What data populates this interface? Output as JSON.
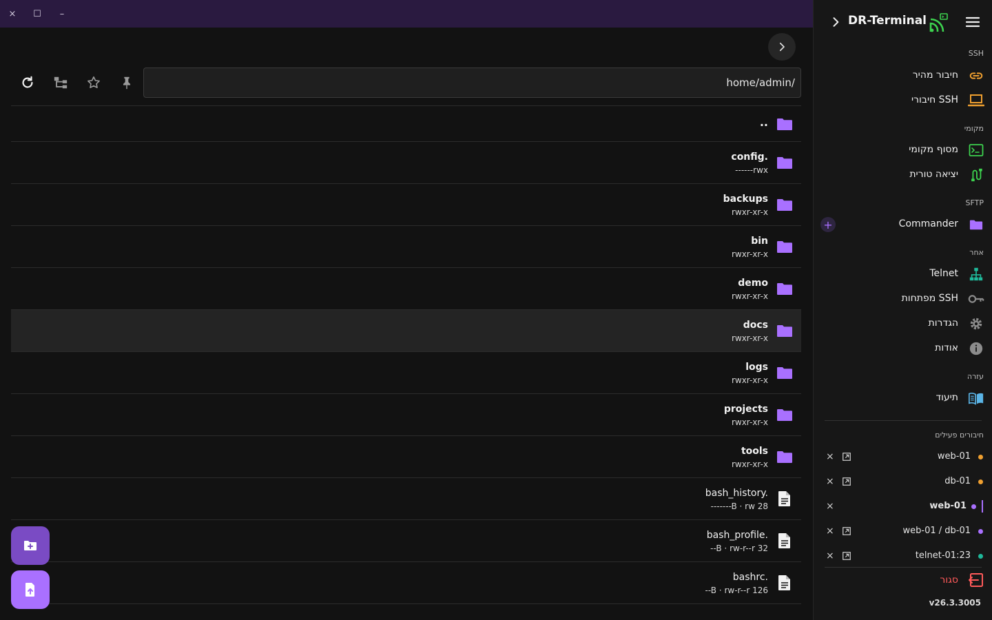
{
  "window": {
    "close": "×",
    "maximize": "☐",
    "minimize": "–"
  },
  "toolbar": {
    "path": "home/admin/"
  },
  "files": [
    {
      "name": "..",
      "perm": "",
      "type": "folder"
    },
    {
      "name": "config.",
      "perm": "------rwx",
      "type": "folder"
    },
    {
      "name": "backups",
      "perm": "rwxr-xr-x",
      "type": "folder"
    },
    {
      "name": "bin",
      "perm": "rwxr-xr-x",
      "type": "folder"
    },
    {
      "name": "demo",
      "perm": "rwxr-xr-x",
      "type": "folder"
    },
    {
      "name": "docs",
      "perm": "rwxr-xr-x",
      "type": "folder",
      "selected": true
    },
    {
      "name": "logs",
      "perm": "rwxr-xr-x",
      "type": "folder"
    },
    {
      "name": "projects",
      "perm": "rwxr-xr-x",
      "type": "folder"
    },
    {
      "name": "tools",
      "perm": "rwxr-xr-x",
      "type": "folder"
    },
    {
      "name": "bash_history.",
      "perm": "-------B · rw 28",
      "type": "file"
    },
    {
      "name": "bash_profile.",
      "perm": "--B · rw-r--r 32",
      "type": "file"
    },
    {
      "name": "bashrc.",
      "perm": "--B · rw-r--r 126",
      "type": "file"
    }
  ],
  "sidebar": {
    "title": "DR-Terminal",
    "sections": {
      "ssh": "SSH",
      "local": "מקומי",
      "sftp": "SFTP",
      "other": "אחר",
      "help": "עזרה",
      "active": "חיבורים פעילים"
    },
    "items": {
      "quick_connect": "חיבור מהיר",
      "ssh_connections": "חיבורי SSH",
      "local_terminal": "מסוף מקומי",
      "serial_port": "יציאה טורית",
      "commander": "Commander",
      "telnet": "Telnet",
      "ssh_keys": "מפתחות SSH",
      "settings": "הגדרות",
      "about": "אודות",
      "docs": "תיעוד"
    },
    "connections": [
      {
        "label": "web-01",
        "color": "#f0a030",
        "detach": true
      },
      {
        "label": "db-01",
        "color": "#f0a030",
        "detach": true
      },
      {
        "label": "web-01",
        "color": "#a970ff",
        "detach": false,
        "active": true
      },
      {
        "label": "web-01 / db-01",
        "color": "#a970ff",
        "detach": true
      },
      {
        "label": "telnet-01:23",
        "color": "#1fb89a",
        "detach": true
      }
    ],
    "close_x": "×",
    "logout": "סגור",
    "version": "v26.3.3005"
  },
  "colors": {
    "accent": "#a970ff",
    "folder": "#a970ff",
    "orange": "#f0a030",
    "green": "#3dd34f",
    "teal": "#1fb89a",
    "danger": "#ff5a5a",
    "docs_blue": "#5ab4e6"
  }
}
